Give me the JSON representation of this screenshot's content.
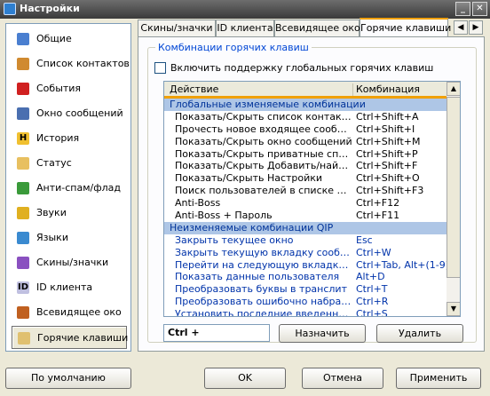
{
  "window": {
    "title": "Настройки",
    "minimize_glyph": "_",
    "close_glyph": "✕"
  },
  "sidebar": {
    "items": [
      {
        "label": "Общие",
        "icon": "settings-icon",
        "glyph": "",
        "color": "#4a7fd0"
      },
      {
        "label": "Список контактов",
        "icon": "contacts-icon",
        "glyph": "",
        "color": "#d08a30"
      },
      {
        "label": "События",
        "icon": "events-icon",
        "glyph": "",
        "color": "#d02020"
      },
      {
        "label": "Окно сообщений",
        "icon": "message-window-icon",
        "glyph": "",
        "color": "#4a6fb0"
      },
      {
        "label": "История",
        "icon": "history-icon",
        "glyph": "H",
        "color": "#f0c030"
      },
      {
        "label": "Статус",
        "icon": "status-icon",
        "glyph": "",
        "color": "#e8c060"
      },
      {
        "label": "Анти-спам/флад",
        "icon": "antispam-icon",
        "glyph": "",
        "color": "#3a9a3a"
      },
      {
        "label": "Звуки",
        "icon": "sounds-icon",
        "glyph": "",
        "color": "#e0b020"
      },
      {
        "label": "Языки",
        "icon": "languages-icon",
        "glyph": "",
        "color": "#3a8ad0"
      },
      {
        "label": "Скины/значки",
        "icon": "skins-icon",
        "glyph": "",
        "color": "#8a50c0"
      },
      {
        "label": "ID клиента",
        "icon": "client-id-icon",
        "glyph": "ID",
        "color": "#c0c0e0"
      },
      {
        "label": "Всевидящее око",
        "icon": "all-seeing-eye-icon",
        "glyph": "",
        "color": "#c06020"
      },
      {
        "label": "Горячие клавиши",
        "icon": "hotkeys-icon",
        "glyph": "",
        "color": "#e0c070"
      }
    ]
  },
  "tabs": [
    {
      "label": "Скины/значки"
    },
    {
      "label": "ID клиента"
    },
    {
      "label": "Всевидящее око"
    },
    {
      "label": "Горячие клавиши"
    }
  ],
  "tab_arrows": {
    "left": "◀",
    "right": "▶"
  },
  "panel": {
    "group_title": "Комбинации горячих клавиш",
    "enable_global_label": "Включить поддержку глобальных горячих клавиш",
    "enable_global_checked": false,
    "columns": {
      "action": "Действие",
      "combo": "Комбинация"
    },
    "rows": [
      {
        "type": "header",
        "action": "Глобальные изменяемые комбинации",
        "combo": ""
      },
      {
        "type": "item",
        "action": "Показать/Скрыть список контактов",
        "combo": "Ctrl+Shift+A"
      },
      {
        "type": "item",
        "action": "Прочесть новое входящее сообщение",
        "combo": "Ctrl+Shift+I"
      },
      {
        "type": "item",
        "action": "Показать/Скрыть окно сообщений",
        "combo": "Ctrl+Shift+M"
      },
      {
        "type": "item",
        "action": "Показать/Скрыть приватные списки",
        "combo": "Ctrl+Shift+P"
      },
      {
        "type": "item",
        "action": "Показать/Скрыть Добавить/найти ...",
        "combo": "Ctrl+Shift+F"
      },
      {
        "type": "item",
        "action": "Показать/Скрыть Настройки",
        "combo": "Ctrl+Shift+O"
      },
      {
        "type": "item",
        "action": "Поиск пользователей в списке конт...",
        "combo": "Ctrl+Shift+F3"
      },
      {
        "type": "item",
        "action": "Anti-Boss",
        "combo": "Ctrl+F12"
      },
      {
        "type": "item",
        "action": "Anti-Boss + Пароль",
        "combo": "Ctrl+F11"
      },
      {
        "type": "header",
        "action": "Неизменяемые комбинации QIP",
        "combo": ""
      },
      {
        "type": "blue",
        "action": "Закрыть текущее окно",
        "combo": "Esc"
      },
      {
        "type": "blue",
        "action": "Закрыть текущую вкладку сообщений",
        "combo": "Ctrl+W"
      },
      {
        "type": "blue",
        "action": "Перейти на следующую вкладку соо...",
        "combo": "Ctrl+Tab, Alt+(1-9)"
      },
      {
        "type": "blue",
        "action": "Показать данные пользователя",
        "combo": "Alt+D"
      },
      {
        "type": "blue",
        "action": "Преобразовать буквы в транслит",
        "combo": "Ctrl+T"
      },
      {
        "type": "blue",
        "action": "Преобразовать ошибочно набранны...",
        "combo": "Ctrl+R"
      },
      {
        "type": "blue",
        "action": "Установить последние введенные с...",
        "combo": "Ctrl+S"
      }
    ],
    "scroll_up": "▲",
    "scroll_down": "▼",
    "key_input_value": "Ctrl +",
    "assign_label": "Назначить",
    "delete_label": "Удалить"
  },
  "footer": {
    "defaults_label": "По умолчанию",
    "ok_label": "OK",
    "cancel_label": "Отмена",
    "apply_label": "Применить"
  }
}
